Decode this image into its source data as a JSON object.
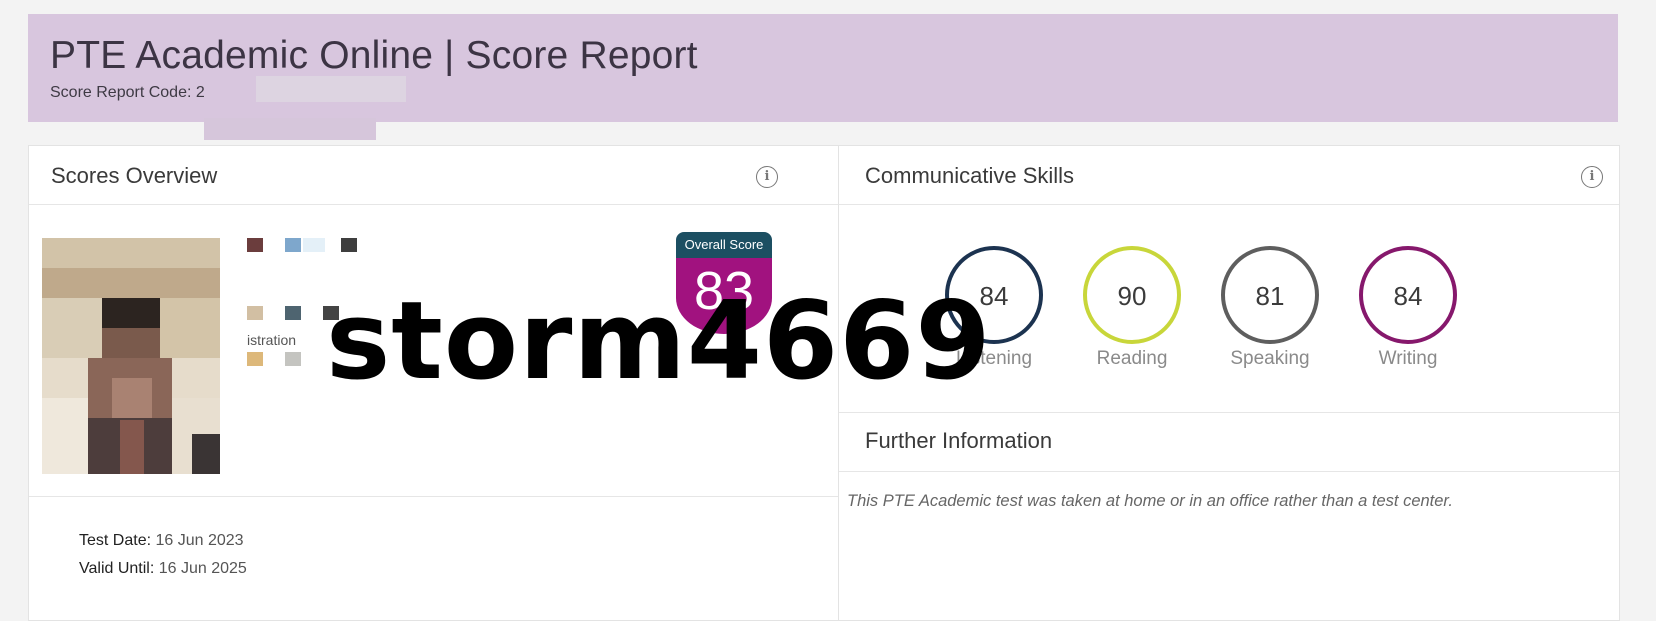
{
  "header": {
    "title": "PTE Academic Online | Score Report",
    "code_label": "Score Report Code: 2",
    "background_color": "#d8c6de"
  },
  "scores_overview": {
    "title": "Scores Overview",
    "info_icon": "info-icon",
    "partial_label": "istration",
    "overall": {
      "label": "Overall Score",
      "value": "83",
      "top_color": "#1c4f62",
      "bottom_color": "#a1127f"
    },
    "test_date": {
      "label": "Test Date:",
      "value": "16 Jun 2023"
    },
    "valid_until": {
      "label": "Valid Until:",
      "value": "16 Jun 2025"
    }
  },
  "communicative_skills": {
    "title": "Communicative Skills",
    "info_icon": "info-icon",
    "skills": [
      {
        "name": "Listening",
        "value": "84",
        "color": "#1c3350"
      },
      {
        "name": "Reading",
        "value": "90",
        "color": "#c8d63a"
      },
      {
        "name": "Speaking",
        "value": "81",
        "color": "#5e5e5e"
      },
      {
        "name": "Writing",
        "value": "84",
        "color": "#86186c"
      }
    ]
  },
  "further_information": {
    "title": "Further Information",
    "text": "This PTE Academic test was taken at home or in an office rather than a test center."
  },
  "watermark": {
    "text": "storm4669"
  }
}
